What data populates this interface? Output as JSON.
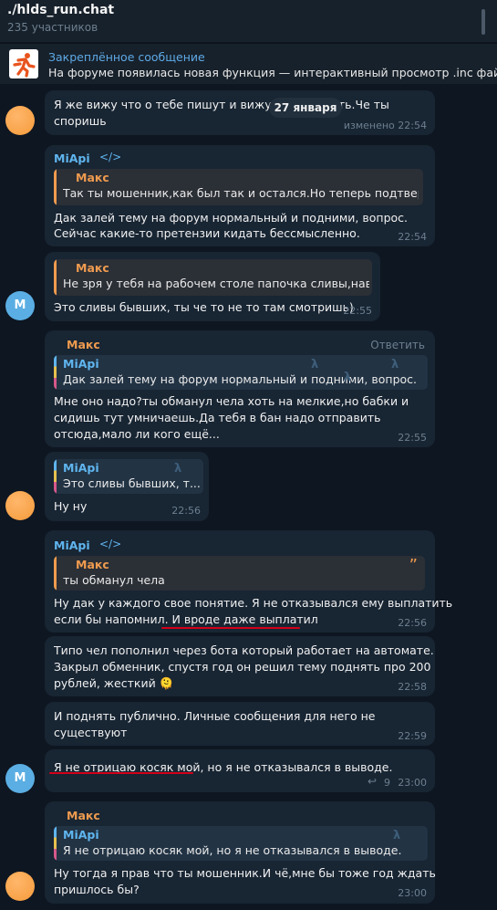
{
  "chat": {
    "title": "./hlds_run.chat",
    "members": "235 участников"
  },
  "pinned": {
    "title": "Закреплённое сообщение",
    "text": "На форуме появилась новая функция — интерактивный просмотр .inc файлов"
  },
  "date_pill": "27 января",
  "messages": [
    {
      "lines": [
        "Я же вижу что о тебе пишут и вижу что ты",
        "споришь"
      ],
      "line1_tail": "сть.Че ты",
      "time": "изменено 22:54"
    },
    {
      "sender": "MiApi",
      "quote": {
        "name": "Макс",
        "text": "Так ты мошенник,как был так и остался.Но теперь подтверд..."
      },
      "lines": [
        "Дак залей тему на форум нормальный и подними, вопрос.",
        "Сейчас какие-то претензии кидать бессмысленно."
      ],
      "time": "22:54"
    },
    {
      "quote": {
        "name": "Макс",
        "text": "Не зря у тебя на рабочем столе папочка сливы,нав..."
      },
      "lines": [
        "Это сливы бывших, ты че то не то там смотришь)"
      ],
      "time": "22:55",
      "avatar_letter": "M"
    },
    {
      "sender": "Макс",
      "reply_action": "Ответить",
      "quote": {
        "name": "MiApi",
        "text": "Дак залей тему на форум нормальный и подними, вопрос."
      },
      "lines": [
        "Мне оно надо?ты обманул чела хоть на мелкие,но бабки и",
        "сидишь тут умничаешь.Да тебя в бан надо отправить",
        "отсюда,мало ли кого ещё..."
      ],
      "time": "22:55"
    },
    {
      "quote": {
        "name": "MiApi",
        "text": "Это сливы бывших, т..."
      },
      "lines": [
        "Ну ну"
      ],
      "time": "22:56"
    },
    {
      "sender": "MiApi",
      "quote": {
        "name": "Макс",
        "text": "ты обманул чела"
      },
      "lines": [
        "Ну дак у каждого свое понятие. Я не отказывался ему выплатить",
        "если бы напомнил. И вроде даже выплатил"
      ],
      "time": "22:56"
    },
    {
      "lines": [
        "Типо чел пополнил через бота который работает на автомате.",
        "Закрыл обменник, спустя год он решил тему поднять про 200",
        "рублей, жесткий 🫠"
      ],
      "time": "22:58"
    },
    {
      "lines": [
        "И поднять публично. Личные сообщения для него не",
        "существуют"
      ],
      "time": "22:59"
    },
    {
      "lines": [
        "Я не отрицаю косяк мой, но я не отказывался в выводе."
      ],
      "time": "23:00",
      "replies": "9",
      "avatar_letter": "M"
    },
    {
      "sender": "Макс",
      "quote": {
        "name": "MiApi",
        "text": "Я не отрицаю косяк мой, но я не отказывался в выводе."
      },
      "lines": [
        "Ну тогда я прав что ты мошенник.И чё,мне бы тоже год ждать",
        "пришлось бы?"
      ],
      "time": "23:00"
    }
  ],
  "colors": {
    "background": "#0e1621",
    "bubble": "#182533",
    "accent_blue": "#5fb5ee",
    "accent_orange": "#ef9b4f",
    "underline_red": "#d3001a"
  }
}
